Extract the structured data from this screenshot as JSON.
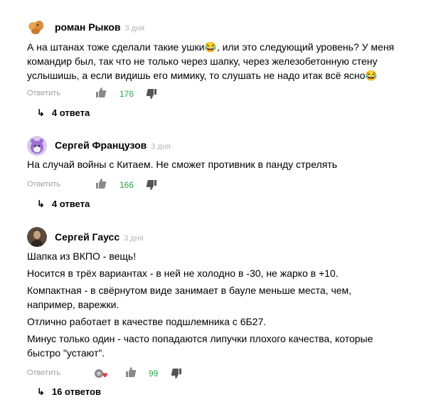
{
  "comments": [
    {
      "author": "роман Рыков",
      "time": "3 дня",
      "avatar_icon": "dog-avatar-icon",
      "paragraphs": [
        "А на штанах тоже сделали такие ушки😂, или это следующий уровень? У меня командир был, так что не только через шапку, через железобетонную стену услышишь, а если видишь его мимику, то слушать не надо итак всё ясно😂"
      ],
      "reply_label": "Ответить",
      "likes": "176",
      "replies_label": "4 ответа"
    },
    {
      "author": "Сергей Французов",
      "time": "3 дня",
      "avatar_icon": "purple-creature-avatar-icon",
      "paragraphs": [
        "На случай войны с Китаем. Не сможет противник в панду стрелять"
      ],
      "reply_label": "Ответить",
      "likes": "166",
      "replies_label": "4 ответа"
    },
    {
      "author": "Сергей Гаусс",
      "time": "3 дня",
      "avatar_icon": "photo-avatar-icon",
      "paragraphs": [
        "Шапка из ВКПО - вещь!",
        "Носится в трёх вариантах - в ней не холодно в -30, не жарко в +10.",
        "Компактная - в свёрнутом виде занимает в бауле меньше места, чем, например, варежки.",
        "Отлично работает в качестве подшлемника с 6Б27.",
        "Минус только один - часто попадаются липучки плохого качества, которые быстро \"устают\"."
      ],
      "reply_label": "Ответить",
      "likes": "99",
      "replies_label": "16 ответов"
    }
  ],
  "colors": {
    "likes": "#2aa845",
    "muted": "#a0a0a0",
    "time": "#b4b4b4"
  }
}
